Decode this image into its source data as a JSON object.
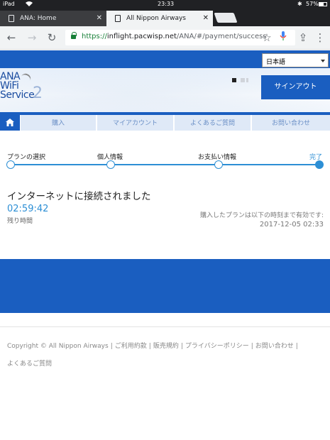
{
  "status_bar": {
    "device": "iPad",
    "time": "23:33",
    "battery": "57%"
  },
  "tabs": [
    {
      "title": "ANA: Home"
    },
    {
      "title": "All Nippon Airways"
    }
  ],
  "toolbar": {
    "url_scheme": "https://",
    "url_host": "inflight.pacwisp.net",
    "url_path": "/ANA/#/payment/success"
  },
  "header": {
    "language": "日本語",
    "logo": {
      "line1": "ANA",
      "line2": "WiFi",
      "line3": "Service",
      "version": "2"
    },
    "signin_label": "サインアウト"
  },
  "nav": {
    "items": [
      "購入",
      "マイアカウント",
      "よくあるご質問",
      "お問い合わせ"
    ]
  },
  "progress": {
    "steps": [
      "プランの選択",
      "個人情報",
      "お支払い情報",
      "完了"
    ]
  },
  "main": {
    "heading": "インターネットに接続されました",
    "time_remaining": "02:59:42",
    "time_remaining_label": "残り時間",
    "valid_note": "購入したプランは以下の時刻まで有効です:",
    "valid_until": "2017-12-05 02:33"
  },
  "footer": {
    "copyright": "Copyright © All Nippon Airways",
    "links": [
      "ご利用約款",
      "販売規約",
      "プライバシーポリシー",
      "お問い合わせ",
      "よくあるご質問"
    ]
  },
  "colors": {
    "brand_blue": "#1a5ec0",
    "accent_blue": "#2d8fd5",
    "nav_bg": "#dfe9f7"
  }
}
